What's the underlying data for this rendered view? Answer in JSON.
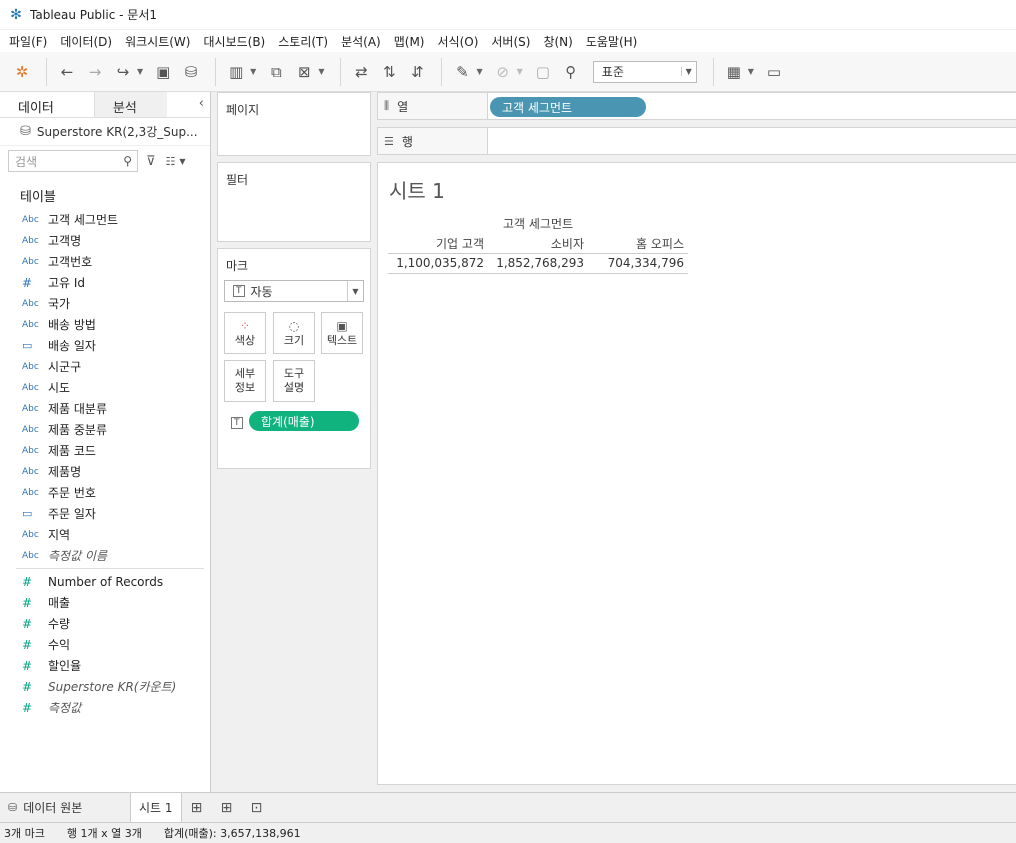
{
  "window": {
    "title": "Tableau Public - 문서1"
  },
  "menu": [
    "파일(F)",
    "데이터(D)",
    "워크시트(W)",
    "대시보드(B)",
    "스토리(T)",
    "분석(A)",
    "맵(M)",
    "서식(O)",
    "서버(S)",
    "창(N)",
    "도움말(H)"
  ],
  "toolbar": {
    "fit_select": "표준"
  },
  "datapane": {
    "tab_data": "데이터",
    "tab_analysis": "분석",
    "datasource": "Superstore KR(2,3강_Sup...",
    "search_placeholder": "검색",
    "tables_label": "테이블",
    "dimensions": [
      {
        "type": "Abc",
        "name": "고객 세그먼트"
      },
      {
        "type": "Abc",
        "name": "고객명"
      },
      {
        "type": "Abc",
        "name": "고객번호"
      },
      {
        "type": "#",
        "name": "고유 Id"
      },
      {
        "type": "Abc",
        "name": "국가"
      },
      {
        "type": "Abc",
        "name": "배송 방법"
      },
      {
        "type": "date",
        "name": "배송 일자"
      },
      {
        "type": "Abc",
        "name": "시군구"
      },
      {
        "type": "Abc",
        "name": "시도"
      },
      {
        "type": "Abc",
        "name": "제품 대분류"
      },
      {
        "type": "Abc",
        "name": "제품 중분류"
      },
      {
        "type": "Abc",
        "name": "제품 코드"
      },
      {
        "type": "Abc",
        "name": "제품명"
      },
      {
        "type": "Abc",
        "name": "주문 번호"
      },
      {
        "type": "date",
        "name": "주문 일자"
      },
      {
        "type": "Abc",
        "name": "지역"
      },
      {
        "type": "Abc",
        "name": "측정값 이름"
      }
    ],
    "measures": [
      {
        "type": "#",
        "name": "Number of Records"
      },
      {
        "type": "#",
        "name": "매출"
      },
      {
        "type": "#",
        "name": "수량"
      },
      {
        "type": "#",
        "name": "수익"
      },
      {
        "type": "#",
        "name": "할인율"
      },
      {
        "type": "#",
        "name": "Superstore KR(카운트)"
      },
      {
        "type": "#",
        "name": "측정값"
      }
    ]
  },
  "cards": {
    "pages": "페이지",
    "filters": "필터",
    "marks": "마크",
    "marks_type": "자동",
    "color": "색상",
    "size": "크기",
    "text": "텍스트",
    "detail_line1": "세부",
    "detail_line2": "정보",
    "tooltip_line1": "도구",
    "tooltip_line2": "설명",
    "text_pill": "합계(매출)"
  },
  "shelves": {
    "columns_label": "열",
    "rows_label": "행",
    "columns_pill": "고객 세그먼트"
  },
  "view": {
    "sheet_title": "시트 1",
    "column_header": "고객 세그먼트",
    "columns": [
      "기업 고객",
      "소비자",
      "홈 오피스"
    ],
    "values": [
      "1,100,035,872",
      "1,852,768,293",
      "704,334,796"
    ]
  },
  "bottom": {
    "datasource_tab": "데이터 원본",
    "sheet_tab": "시트 1"
  },
  "status": {
    "marks": "3개 마크",
    "dims": "행 1개 x 열 3개",
    "sum": "합계(매출): 3,657,138,961"
  }
}
